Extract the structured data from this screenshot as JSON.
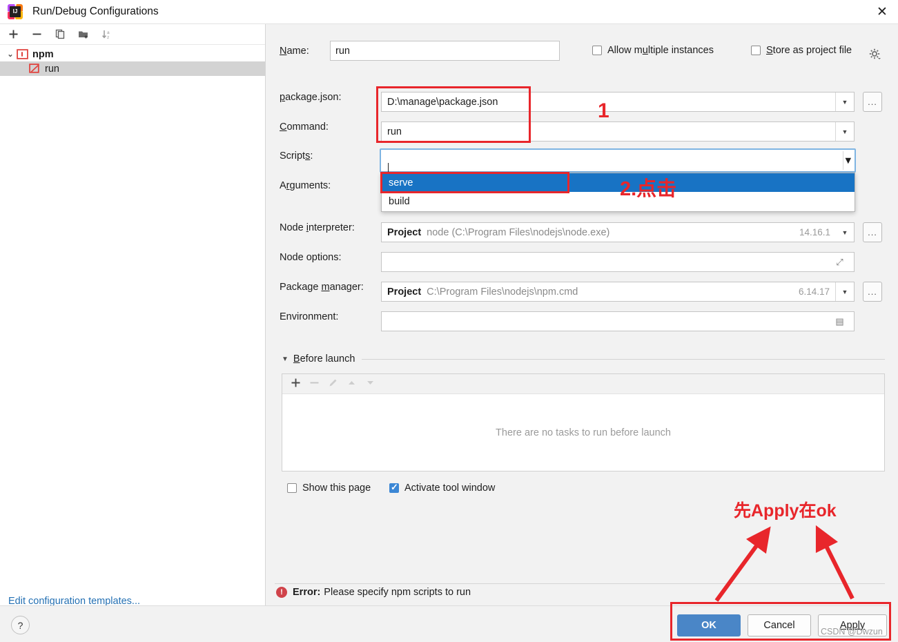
{
  "window": {
    "title": "Run/Debug Configurations",
    "app_icon": "intellij-idea-icon",
    "close_label": "✕"
  },
  "sidebar": {
    "toolbar": [
      {
        "name": "add-configuration-button",
        "icon": "plus-icon"
      },
      {
        "name": "remove-configuration-button",
        "icon": "minus-icon"
      },
      {
        "name": "copy-configuration-button",
        "icon": "copy-icon"
      },
      {
        "name": "new-folder-button",
        "icon": "folder-add-icon"
      },
      {
        "name": "sort-configurations-button",
        "icon": "sort-alpha-icon"
      }
    ],
    "tree": [
      {
        "label": "npm",
        "type": "group",
        "icon": "npm-icon",
        "expanded": true
      },
      {
        "label": "run",
        "type": "child",
        "icon": "npm-run-icon",
        "selected": true
      }
    ],
    "edit_templates_link": "Edit configuration templates..."
  },
  "form": {
    "name_label": "Name:",
    "name_mnemonic": "N",
    "name_value": "run",
    "allow_multiple_instances": {
      "label": "Allow multiple instances",
      "mnemonic": "u",
      "checked": false
    },
    "store_as_project_file": {
      "label": "Store as project file",
      "mnemonic": "S",
      "checked": false
    },
    "gear_icon": "gear-icon",
    "package_json": {
      "label": "package.json:",
      "mnemonic": "p",
      "value": "D:\\manage\\package.json"
    },
    "command": {
      "label": "Command:",
      "mnemonic": "C",
      "value": "run"
    },
    "scripts": {
      "label": "Scripts:",
      "mnemonic": "s",
      "value": "",
      "focused": true,
      "options": [
        "serve",
        "build"
      ],
      "highlighted_option": "serve"
    },
    "arguments": {
      "label": "Arguments:",
      "mnemonic": "r",
      "value": ""
    },
    "node_interpreter": {
      "label": "Node interpreter:",
      "mnemonic": "i",
      "scope": "Project",
      "path": "node (C:\\Program Files\\nodejs\\node.exe)",
      "version": "14.16.1"
    },
    "node_options": {
      "label": "Node options:",
      "value": ""
    },
    "package_manager": {
      "label": "Package manager:",
      "mnemonic": "m",
      "scope": "Project",
      "path": "C:\\Program Files\\nodejs\\npm.cmd",
      "version": "6.14.17"
    },
    "environment": {
      "label": "Environment:",
      "value": ""
    },
    "browse_button_label": "...",
    "before_launch": {
      "title": "Before launch",
      "mnemonic": "B",
      "expanded": true,
      "toolbar": [
        {
          "name": "add-task-button",
          "icon": "plus-icon",
          "enabled": true
        },
        {
          "name": "remove-task-button",
          "icon": "minus-icon",
          "enabled": false
        },
        {
          "name": "edit-task-button",
          "icon": "pencil-icon",
          "enabled": false
        },
        {
          "name": "move-task-up-button",
          "icon": "arrow-up-icon",
          "enabled": false
        },
        {
          "name": "move-task-down-button",
          "icon": "arrow-down-icon",
          "enabled": false
        }
      ],
      "empty_message": "There are no tasks to run before launch"
    },
    "show_this_page": {
      "label": "Show this page",
      "checked": false
    },
    "activate_tool_window": {
      "label": "Activate tool window",
      "checked": true
    }
  },
  "status": {
    "error_prefix": "Error:",
    "error_message": "Please specify npm scripts to run",
    "error_icon": "error-circle-icon",
    "error_color": "#d0434a"
  },
  "buttons": {
    "help": "?",
    "ok": "OK",
    "cancel": "Cancel",
    "apply": "Apply"
  },
  "annotations": {
    "step_one": "1",
    "step_two": "2.点击",
    "apply_hint": "先Apply在ok",
    "color": "#e8262b"
  },
  "watermark": "CSDN @Dwzun"
}
